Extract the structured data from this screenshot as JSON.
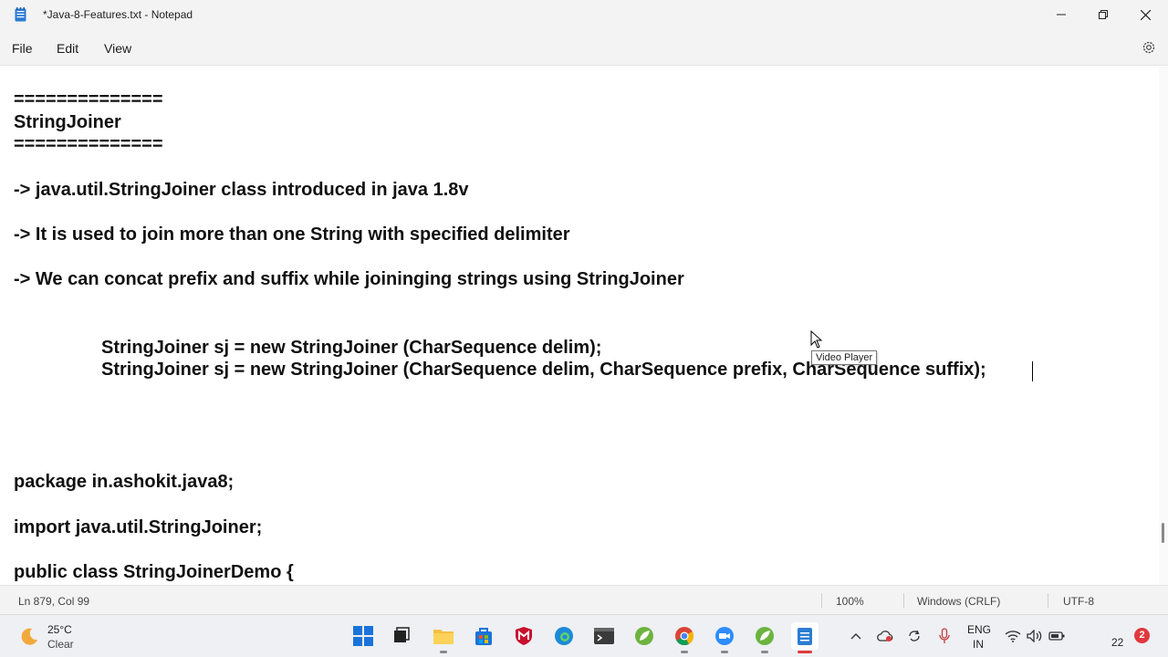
{
  "window": {
    "title": "*Java-8-Features.txt - Notepad"
  },
  "menu": {
    "file": "File",
    "edit": "Edit",
    "view": "View"
  },
  "editor": {
    "lines": [
      "==============",
      "StringJoiner",
      "==============",
      "-> java.util.StringJoiner class introduced in java 1.8v",
      "-> It is used to join more than one String with specified delimiter",
      "-> We can concat prefix and suffix while joininging strings using StringJoiner",
      "StringJoiner sj = new StringJoiner (CharSequence delim);",
      "StringJoiner sj = new StringJoiner (CharSequence delim, CharSequence prefix, CharSequence suffix);",
      "package in.ashokit.java8;",
      "import java.util.StringJoiner;",
      "public class StringJoinerDemo {"
    ],
    "tooltip": "Video Player"
  },
  "status": {
    "position": "Ln 879, Col 99",
    "zoom": "100%",
    "line_ending": "Windows (CRLF)",
    "encoding": "UTF-8"
  },
  "taskbar": {
    "weather_temp": "25°C",
    "weather_desc": "Clear",
    "lang_top": "ENG",
    "lang_bottom": "IN",
    "clock": "22",
    "notification_count": "2"
  },
  "icons": {
    "app": "notepad-icon",
    "settings": "gear-icon",
    "weather": "moon-icon"
  },
  "colors": {
    "chrome": "#f3f3f3",
    "taskbar": "#eef0f4",
    "accent_red": "#e0393e"
  }
}
